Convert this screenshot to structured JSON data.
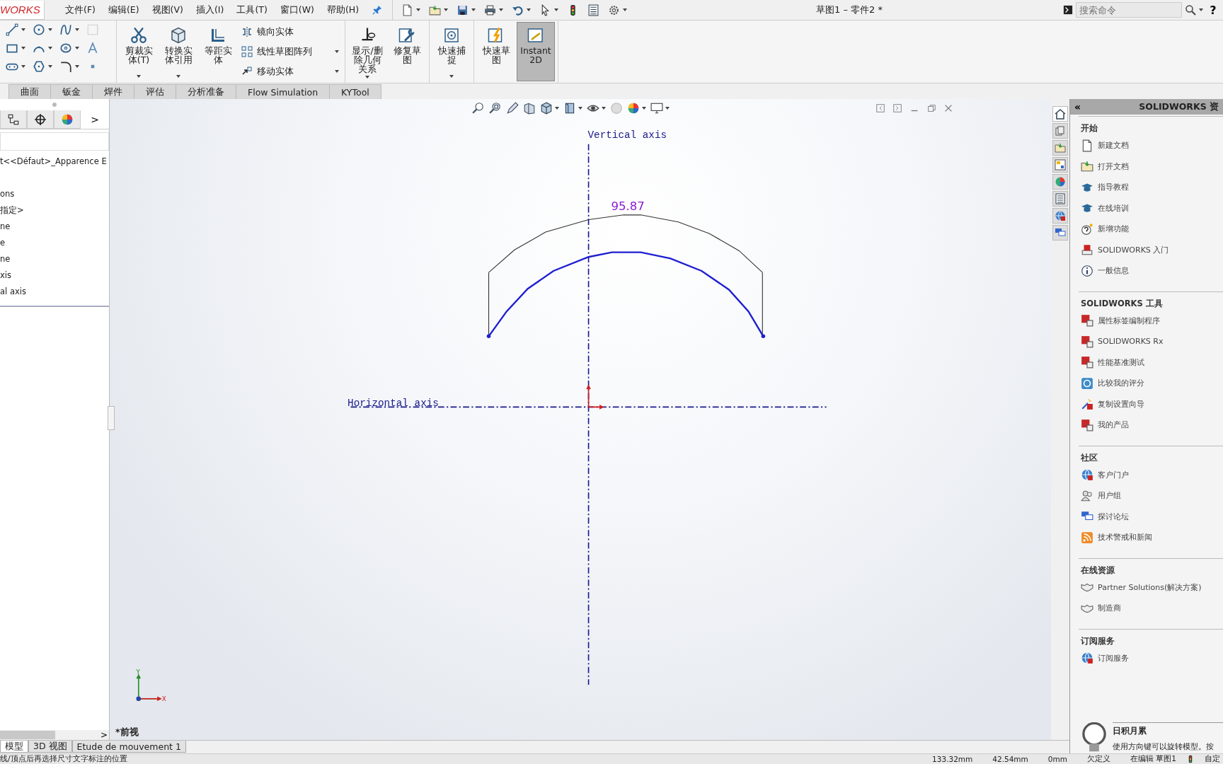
{
  "app": {
    "logo": "WORKS",
    "title": "草图1 – 零件2 *"
  },
  "menu": [
    {
      "label": "文件(F)"
    },
    {
      "label": "编辑(E)"
    },
    {
      "label": "视图(V)"
    },
    {
      "label": "插入(I)"
    },
    {
      "label": "工具(T)"
    },
    {
      "label": "窗口(W)"
    },
    {
      "label": "帮助(H)"
    }
  ],
  "search": {
    "placeholder": "搜索命令"
  },
  "help": "?",
  "ribbon_groups": [
    {
      "buttons": [
        {
          "kind": "large",
          "label": "剪裁实体(T)",
          "selected": false
        },
        {
          "kind": "large",
          "label": "转换实体引用",
          "selected": false
        },
        {
          "kind": "large",
          "label": "等距实体",
          "selected": false
        },
        {
          "kind": "stack",
          "items": [
            {
              "label": "镜向实体"
            },
            {
              "label": "线性草图阵列"
            },
            {
              "label": "移动实体"
            }
          ]
        }
      ]
    },
    {
      "buttons": [
        {
          "kind": "large",
          "label": "显示/删除几何关系",
          "selected": false
        },
        {
          "kind": "large",
          "label": "修复草图",
          "selected": false
        }
      ]
    },
    {
      "buttons": [
        {
          "kind": "large",
          "label": "快速捕捉",
          "selected": false
        }
      ]
    },
    {
      "buttons": [
        {
          "kind": "large",
          "label": "快速草图",
          "selected": false
        },
        {
          "kind": "large",
          "label": "Instant2D",
          "selected": true
        }
      ]
    }
  ],
  "command_tabs": [
    {
      "label": "曲面",
      "selected": false
    },
    {
      "label": "钣金",
      "selected": false
    },
    {
      "label": "焊件",
      "selected": false
    },
    {
      "label": "评估",
      "selected": false
    },
    {
      "label": "分析准备",
      "selected": false
    },
    {
      "label": "Flow Simulation",
      "selected": false
    },
    {
      "label": "KYTool",
      "selected": false
    }
  ],
  "left_panel": {
    "more": ">",
    "tree": [
      "t<<Défaut>_Apparence E",
      "ons",
      "指定>",
      "ne",
      "e",
      "ne",
      "xis",
      "al axis"
    ]
  },
  "canvas": {
    "vertical_axis": "Vertical axis",
    "horizontal_axis": "Horizontal axis",
    "dimension": "95.87",
    "view_name": "*前视",
    "triad": {
      "y": "Y",
      "x": "X"
    }
  },
  "task_pane": {
    "collapse": "«",
    "title": "SOLIDWORKS 资",
    "strip": [
      {
        "selected": true
      },
      {
        "selected": false
      },
      {
        "selected": false
      },
      {
        "selected": false
      },
      {
        "selected": false
      },
      {
        "selected": false
      },
      {
        "selected": false
      },
      {
        "selected": false
      }
    ],
    "sections": [
      {
        "title": "开始",
        "items": [
          {
            "label": "新建文档"
          },
          {
            "label": "打开文档"
          },
          {
            "label": "指导教程"
          },
          {
            "label": "在线培训"
          },
          {
            "label": "新增功能"
          },
          {
            "label": "SOLIDWORKS 入门"
          },
          {
            "label": "一般信息"
          }
        ]
      },
      {
        "title": "SOLIDWORKS 工具",
        "items": [
          {
            "label": "属性标签编制程序"
          },
          {
            "label": "SOLIDWORKS Rx"
          },
          {
            "label": "性能基准测试"
          },
          {
            "label": "比较我的评分"
          },
          {
            "label": "复制设置向导"
          },
          {
            "label": "我的产品"
          }
        ]
      },
      {
        "title": "社区",
        "items": [
          {
            "label": "客户门户"
          },
          {
            "label": "用户组"
          },
          {
            "label": "探讨论坛"
          },
          {
            "label": "技术警戒和新闻"
          }
        ]
      },
      {
        "title": "在线资源",
        "items": [
          {
            "label": "Partner Solutions(解决方案)"
          },
          {
            "label": "制造商"
          }
        ]
      },
      {
        "title": "订阅服务",
        "items": [
          {
            "label": "订阅服务"
          }
        ]
      }
    ],
    "tip": {
      "title": "日积月累",
      "text": "使用方向键可以旋转模型。按"
    }
  },
  "bottom_tabs": [
    {
      "label": "模型",
      "selected": true
    },
    {
      "label": "3D 视图",
      "selected": false
    },
    {
      "label": "Etude de mouvement 1",
      "selected": false
    }
  ],
  "status_bar": {
    "message": "线/顶点后再选择尺寸文字标注的位置",
    "x": "133.32mm",
    "y": "42.54mm",
    "z": "0mm",
    "state": "欠定义",
    "editing": "在编辑 草图1",
    "units": "自定"
  }
}
